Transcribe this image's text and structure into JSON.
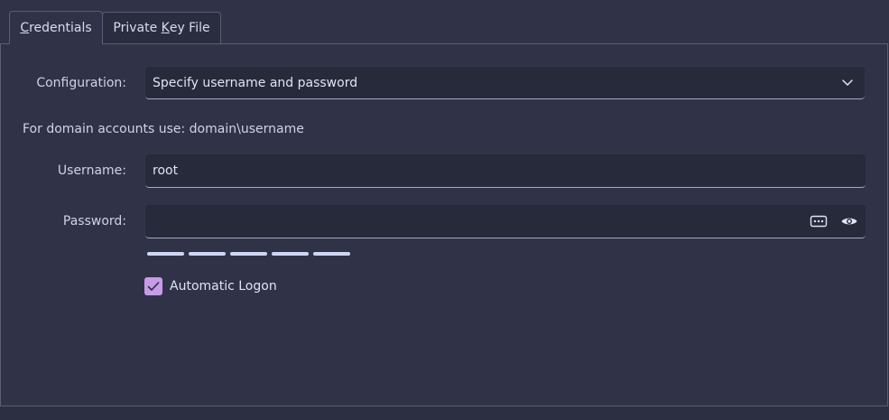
{
  "tabs": {
    "credentials": {
      "prefix": "",
      "mnemonic": "C",
      "rest": "redentials",
      "active": true
    },
    "private_key_file": {
      "prefix": "Private ",
      "mnemonic": "K",
      "rest": "ey File",
      "active": false
    }
  },
  "configuration": {
    "label": "Configuration:",
    "selected": "Specify username and password",
    "icon": "chevron-down-icon"
  },
  "hint": "For domain accounts use: domain\\username",
  "username": {
    "label": "Username:",
    "value": "root"
  },
  "password": {
    "label": "Password:",
    "value": "",
    "generate_icon": "password-generator-icon",
    "reveal_icon": "eye-icon"
  },
  "strength_segments": 5,
  "automatic_logon": {
    "label": "Automatic Logon",
    "checked": true
  },
  "colors": {
    "background": "#303347",
    "field": "#272a3b",
    "accent": "#c79be8",
    "strength": "#cfd6f3"
  }
}
